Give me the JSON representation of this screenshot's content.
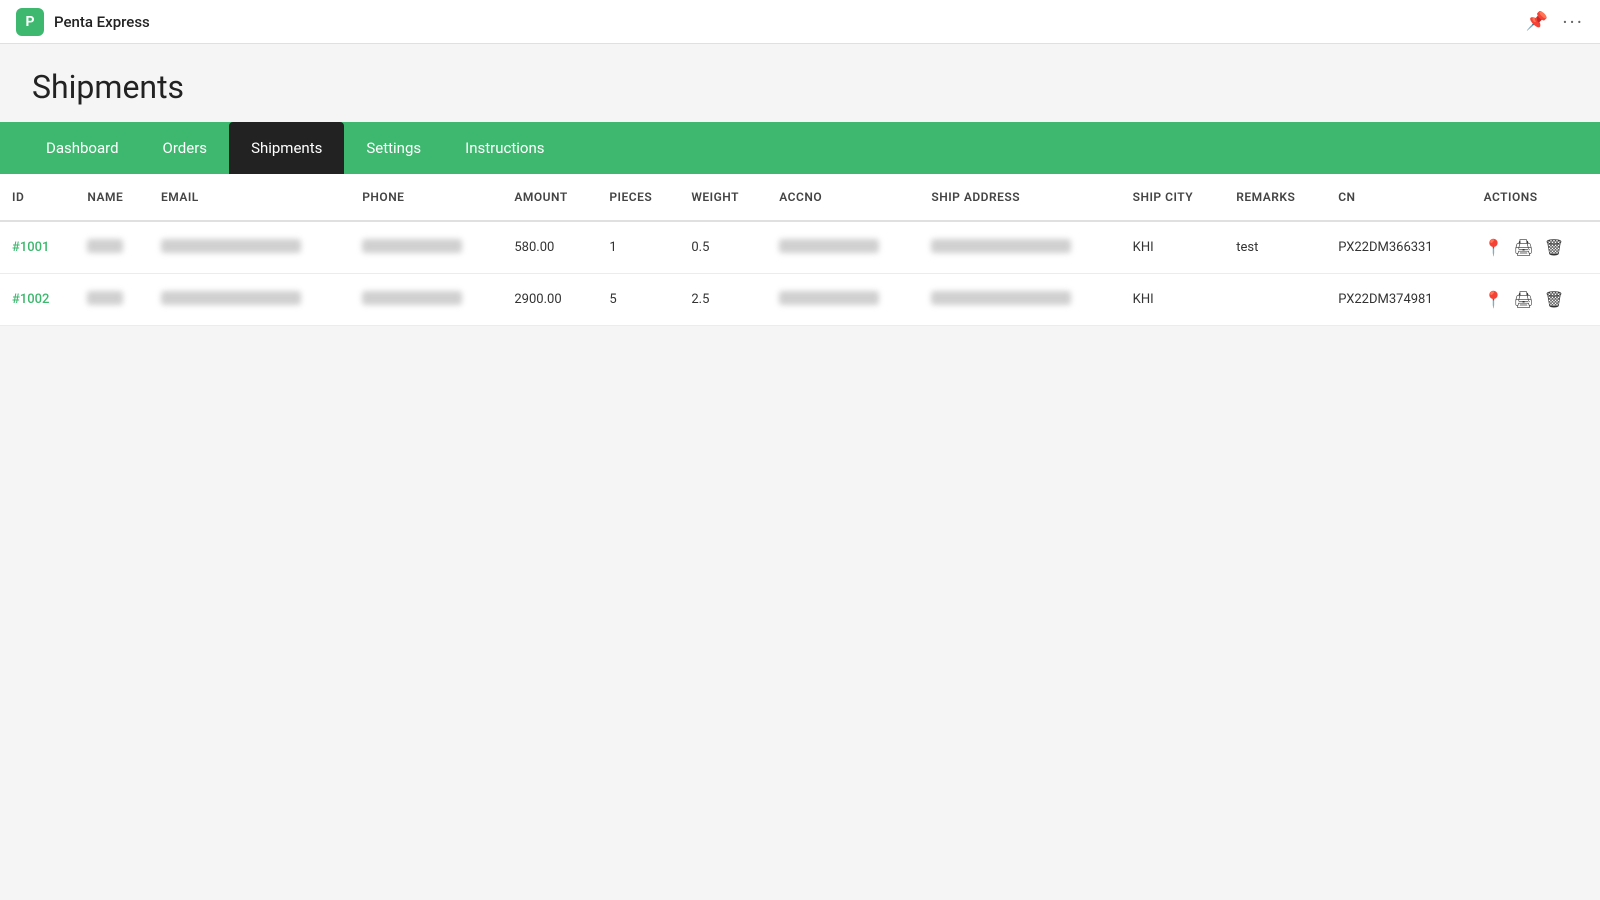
{
  "app": {
    "icon_label": "P",
    "name": "Penta Express",
    "pin_icon": "📌",
    "more_icon": "···"
  },
  "page": {
    "title": "Shipments"
  },
  "nav": {
    "items": [
      {
        "id": "dashboard",
        "label": "Dashboard",
        "active": false
      },
      {
        "id": "orders",
        "label": "Orders",
        "active": false
      },
      {
        "id": "shipments",
        "label": "Shipments",
        "active": true
      },
      {
        "id": "settings",
        "label": "Settings",
        "active": false
      },
      {
        "id": "instructions",
        "label": "Instructions",
        "active": false
      }
    ]
  },
  "table": {
    "columns": [
      {
        "id": "id",
        "label": "ID"
      },
      {
        "id": "name",
        "label": "NAME"
      },
      {
        "id": "email",
        "label": "EMAIL"
      },
      {
        "id": "phone",
        "label": "PHONE"
      },
      {
        "id": "amount",
        "label": "AMOUNT"
      },
      {
        "id": "pieces",
        "label": "PIECES"
      },
      {
        "id": "weight",
        "label": "WEIGHT"
      },
      {
        "id": "accno",
        "label": "ACCNO"
      },
      {
        "id": "ship_address",
        "label": "SHIP ADDRESS"
      },
      {
        "id": "ship_city",
        "label": "SHIP CITY"
      },
      {
        "id": "remarks",
        "label": "REMARKS"
      },
      {
        "id": "cn",
        "label": "CN"
      },
      {
        "id": "actions",
        "label": "ACTIONS"
      }
    ],
    "rows": [
      {
        "id": "#1001",
        "amount": "580.00",
        "pieces": "1",
        "weight": "0.5",
        "ship_city": "KHI",
        "remarks": "test",
        "cn": "PX22DM366331"
      },
      {
        "id": "#1002",
        "amount": "2900.00",
        "pieces": "5",
        "weight": "2.5",
        "ship_city": "KHI",
        "remarks": "",
        "cn": "PX22DM374981"
      }
    ]
  },
  "colors": {
    "green": "#3db86e",
    "dark": "#222222"
  }
}
